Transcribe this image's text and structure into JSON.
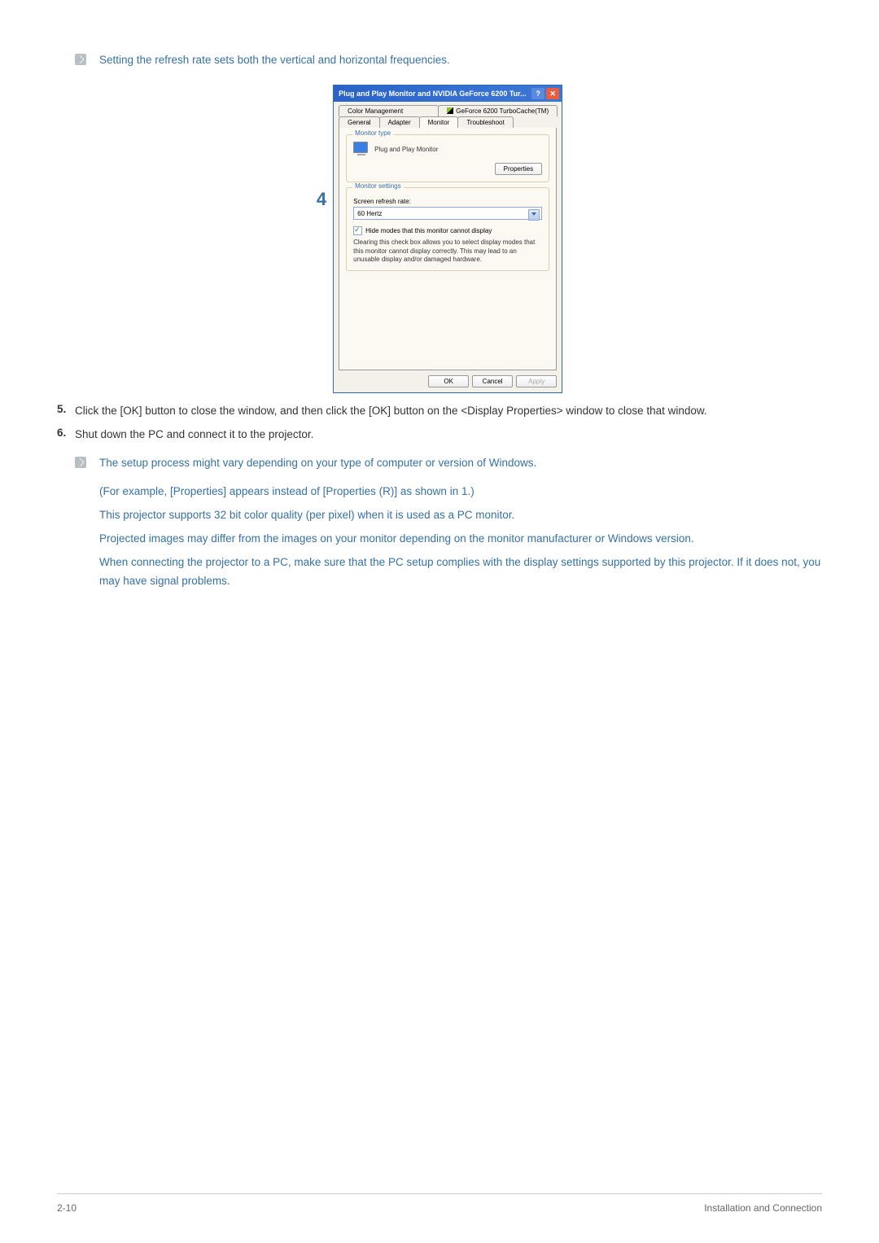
{
  "note_top": "Setting the refresh rate sets both the vertical and horizontal frequencies.",
  "step_number": "4",
  "dialog": {
    "title": "Plug and Play Monitor and NVIDIA GeForce 6200 Tur...",
    "tabs_back": [
      "Color Management",
      "GeForce 6200 TurboCache(TM)"
    ],
    "tabs_front": [
      "General",
      "Adapter",
      "Monitor",
      "Troubleshoot"
    ],
    "active_tab": "Monitor",
    "monitor_type_legend": "Monitor type",
    "monitor_name": "Plug and Play Monitor",
    "properties_btn": "Properties",
    "monitor_settings_legend": "Monitor settings",
    "refresh_label": "Screen refresh rate:",
    "refresh_value": "60 Hertz",
    "hide_modes": "Hide modes that this monitor cannot display",
    "hide_desc": "Clearing this check box allows you to select display modes that this monitor cannot display correctly. This may lead to an unusable display and/or damaged hardware.",
    "ok": "OK",
    "cancel": "Cancel",
    "apply": "Apply"
  },
  "steps": [
    {
      "num": "5.",
      "text": "Click the [OK] button to close the window, and then click the [OK] button on the <Display Properties> window to close that window."
    },
    {
      "num": "6.",
      "text": "Shut down the PC and connect it to the projector."
    }
  ],
  "note2_first": "The setup process might vary depending on your type of computer or version of Windows.",
  "note2_lines": [
    "(For example, [Properties] appears instead of [Properties (R)] as shown in 1.)",
    "This projector supports 32 bit color quality (per pixel) when it is used as a PC monitor.",
    "Projected images may differ from the images on your monitor depending on the monitor manufacturer or Windows version.",
    "When connecting the projector to a PC, make sure that the PC setup complies with the display settings supported by this projector. If it does not, you may have signal problems."
  ],
  "footer_left": "2-10",
  "footer_right": "Installation and Connection"
}
